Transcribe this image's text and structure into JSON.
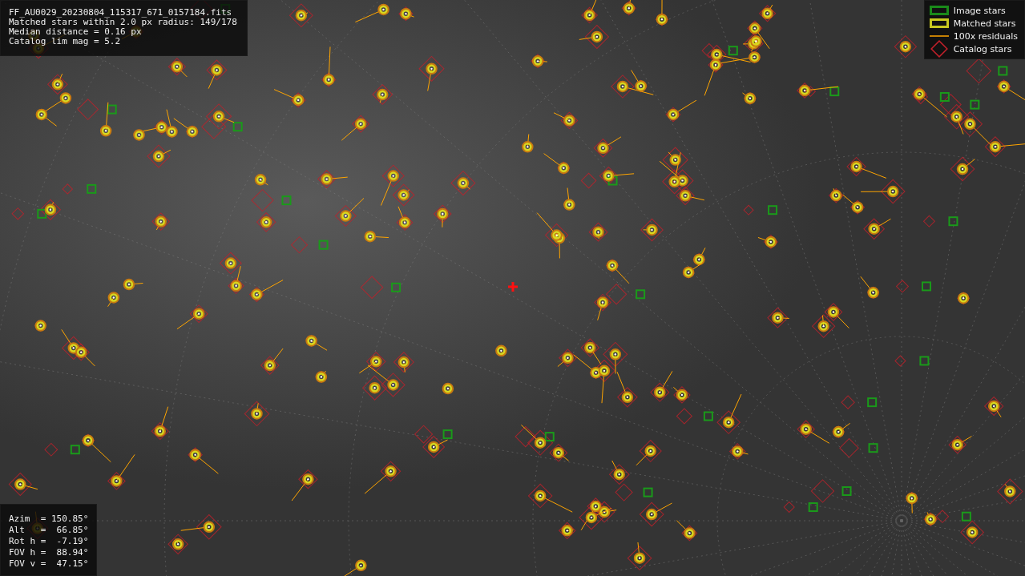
{
  "info": {
    "lines": [
      "FF_AU0029_20230804_115317_671_0157184.fits",
      "Matched stars within 2.0 px radius: 149/178",
      "Median distance = 0.16 px",
      "Catalog lim mag = 5.2"
    ]
  },
  "legend": [
    {
      "kind": "image",
      "label": "Image stars"
    },
    {
      "kind": "matched",
      "label": "Matched stars"
    },
    {
      "kind": "residual",
      "label": "100x residuals"
    },
    {
      "kind": "catalog",
      "label": "Catalog stars"
    }
  ],
  "pointing": {
    "lines": [
      "Azim  = 150.85°",
      "Alt   =  66.85°",
      "Rot h =  -7.19°",
      "FOV h =  88.94°",
      "FOV v =  47.15°"
    ]
  }
}
